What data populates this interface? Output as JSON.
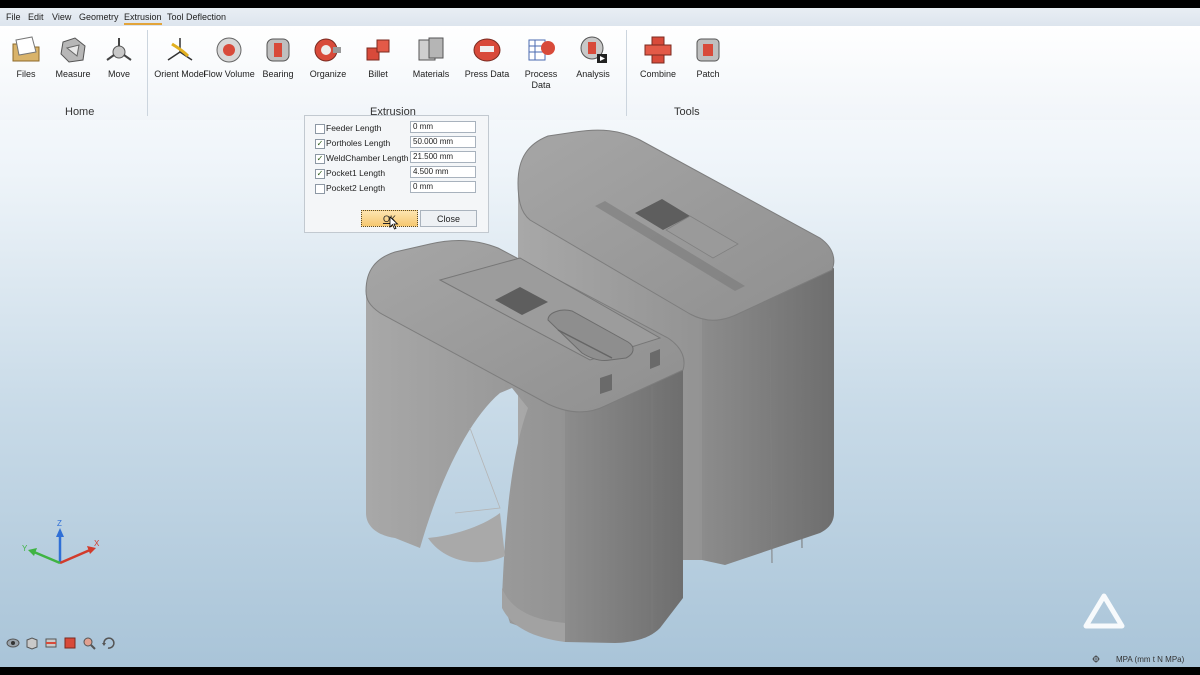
{
  "menu": [
    "File",
    "Edit",
    "View",
    "Geometry",
    "Extrusion",
    "Tool Deflection"
  ],
  "ribbon": {
    "home": {
      "group": "Home",
      "tools": [
        "Files",
        "Measure",
        "Move"
      ]
    },
    "extrusion": {
      "group": "Extrusion",
      "tools": [
        "Orient Model",
        "Flow Volume",
        "Bearing",
        "Organize",
        "Billet",
        "Materials",
        "Press Data",
        "Process Data",
        "Analysis"
      ]
    },
    "tools": {
      "group": "Tools",
      "tools": [
        "Combine",
        "Patch"
      ]
    }
  },
  "dialog": {
    "rows": [
      {
        "label": "Feeder Length",
        "checked": false,
        "value": "0 mm"
      },
      {
        "label": "Portholes Length",
        "checked": true,
        "value": "50.000 mm"
      },
      {
        "label": "WeldChamber Length",
        "checked": true,
        "value": "21.500 mm"
      },
      {
        "label": "Pocket1 Length",
        "checked": true,
        "value": "4.500 mm"
      },
      {
        "label": "Pocket2 Length",
        "checked": false,
        "value": "0 mm"
      }
    ],
    "ok": "OK",
    "close": "Close"
  },
  "axes": {
    "x": "X",
    "y": "Y",
    "z": "Z"
  },
  "status": {
    "units": "MPA (mm t N MPa)"
  },
  "colors": {
    "accent": "#e2a43a",
    "model": "#8a8a8a",
    "icon_red": "#d84a3a"
  }
}
